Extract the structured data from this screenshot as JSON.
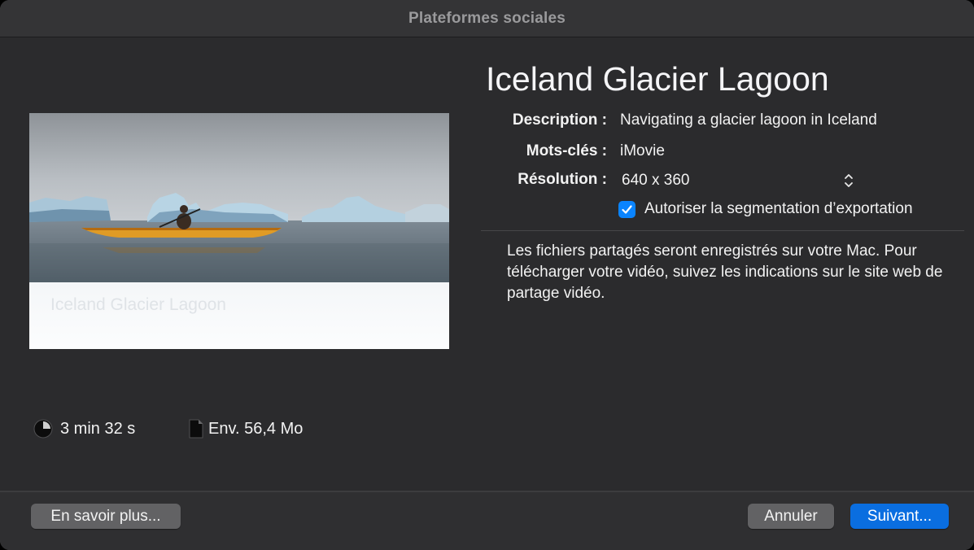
{
  "window": {
    "title": "Plateformes sociales"
  },
  "preview": {
    "overlay_title": "Iceland Glacier Lagoon"
  },
  "stats": {
    "duration": "3 min 32 s",
    "size": "Env. 56,4 Mo"
  },
  "details": {
    "title": "Iceland Glacier Lagoon",
    "description_label": "Description :",
    "description_value": "Navigating a glacier lagoon in Iceland",
    "keywords_label": "Mots-clés :",
    "keywords_value": "iMovie",
    "resolution_label": "Résolution :",
    "resolution_value": "640 x 360",
    "segmentation_label": "Autoriser la segmentation d’exportation",
    "segmentation_checked": true,
    "info_text": "Les fichiers partagés seront enregistrés sur votre Mac. Pour télécharger votre vidéo, suivez les indications sur le site web de partage vidéo."
  },
  "buttons": {
    "learn_more": "En savoir plus...",
    "cancel": "Annuler",
    "next": "Suivant..."
  },
  "colors": {
    "accent": "#0a84ff",
    "primary_button": "#0a6ee0",
    "window_bg": "#2b2b2d"
  },
  "icons": {
    "duration": "clock-icon",
    "size": "document-icon",
    "resolution": "chevron-up-down-icon",
    "checkbox": "checkmark-icon"
  }
}
